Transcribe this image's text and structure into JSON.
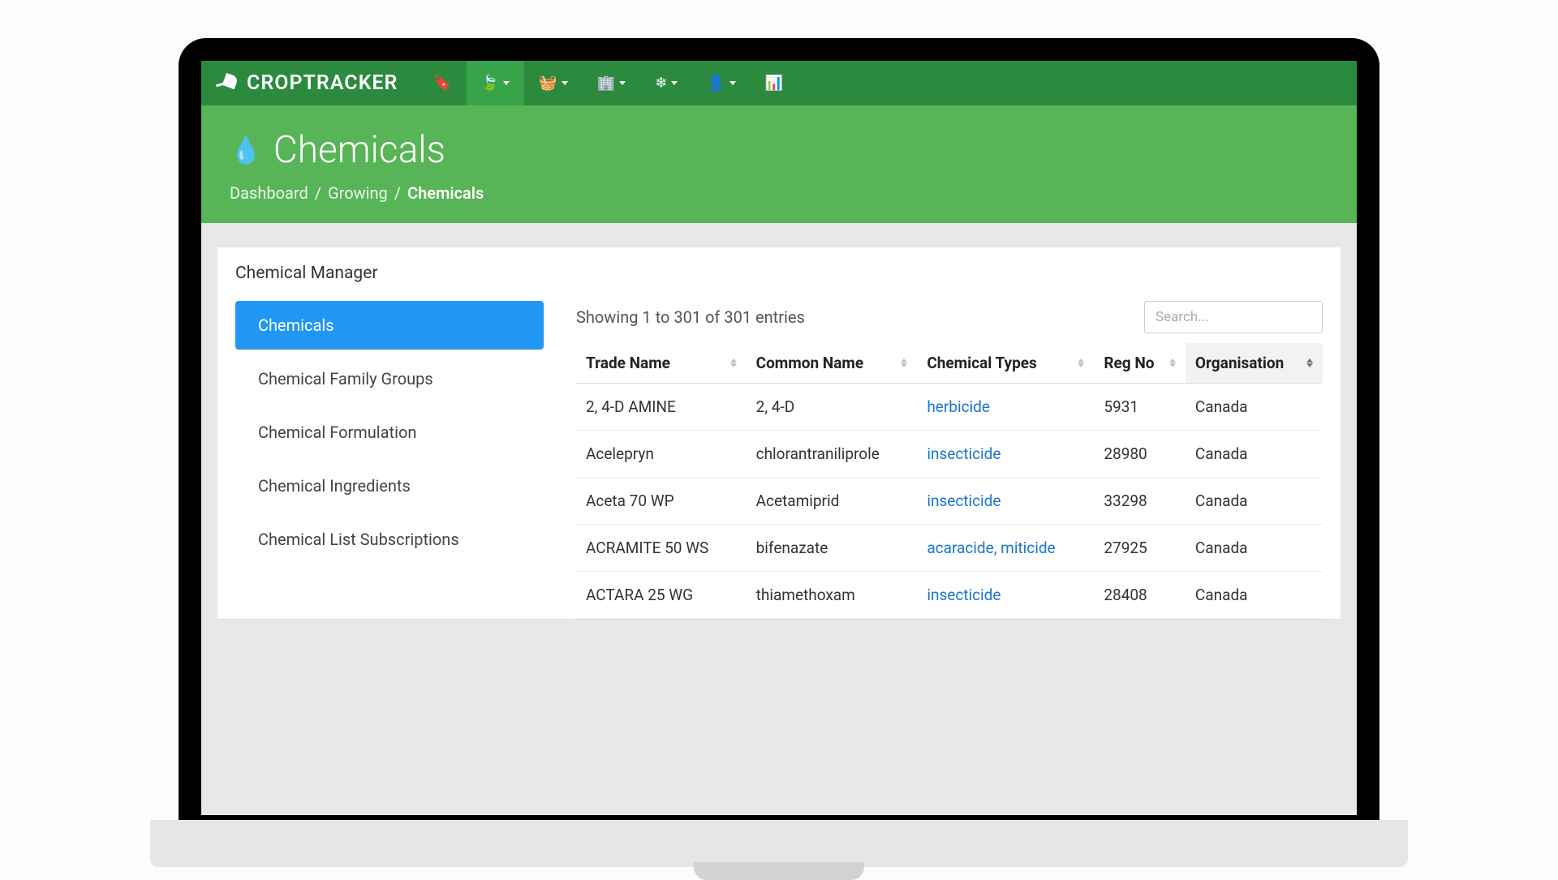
{
  "brand": "CROPTRACKER",
  "page_title": "Chemicals",
  "breadcrumb": {
    "a": "Dashboard",
    "b": "Growing",
    "c": "Chemicals"
  },
  "panel_title": "Chemical Manager",
  "sidebar": {
    "items": [
      "Chemicals",
      "Chemical Family Groups",
      "Chemical Formulation",
      "Chemical Ingredients",
      "Chemical List Subscriptions"
    ]
  },
  "table": {
    "showing": "Showing 1 to 301 of 301 entries",
    "search_placeholder": "Search...",
    "headers": [
      "Trade Name",
      "Common Name",
      "Chemical Types",
      "Reg No",
      "Organisation"
    ],
    "rows": [
      {
        "trade": "2, 4-D AMINE",
        "common": "2, 4-D",
        "types": "herbicide",
        "reg": "5931",
        "org": "Canada"
      },
      {
        "trade": "Acelepryn",
        "common": "chlorantraniliprole",
        "types": "insecticide",
        "reg": "28980",
        "org": "Canada"
      },
      {
        "trade": "Aceta 70 WP",
        "common": "Acetamiprid",
        "types": "insecticide",
        "reg": "33298",
        "org": "Canada"
      },
      {
        "trade": "ACRAMITE 50 WS",
        "common": "bifenazate",
        "types": "acaracide, miticide",
        "reg": "27925",
        "org": "Canada"
      },
      {
        "trade": "ACTARA 25 WG",
        "common": "thiamethoxam",
        "types": "insecticide",
        "reg": "28408",
        "org": "Canada"
      }
    ]
  }
}
